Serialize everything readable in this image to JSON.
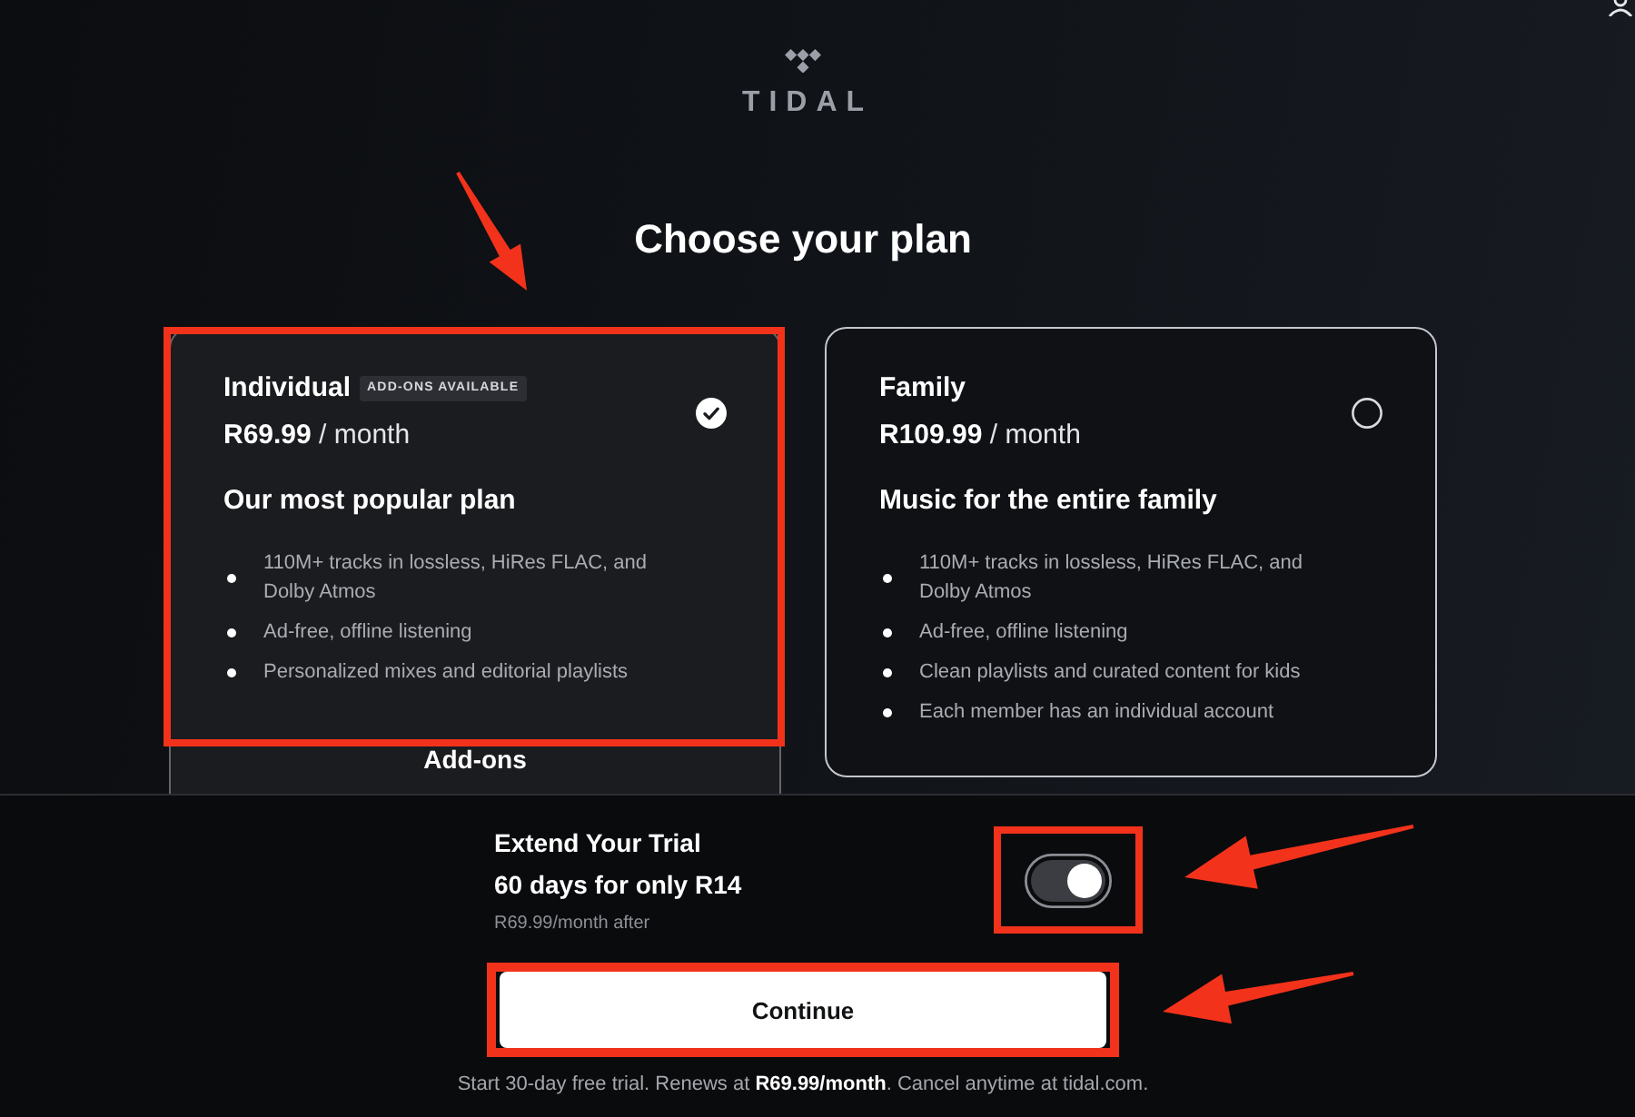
{
  "header": {
    "logo_text": "TIDAL",
    "title": "Choose your plan"
  },
  "plans": [
    {
      "name": "Individual",
      "badge": "ADD-ONS AVAILABLE",
      "price": "**R69.99** / month",
      "tagline": "Our most popular plan",
      "features": [
        "110M+ tracks in lossless, HiRes FLAC, and Dolby Atmos",
        "Ad-free, offline listening",
        "Personalized mixes and editorial playlists"
      ],
      "section_heading": "Add-ons",
      "selected": true
    },
    {
      "name": "Family",
      "price": "**R109.99** / month",
      "tagline": "Music for the entire family",
      "features": [
        "110M+ tracks in lossless, HiRes FLAC, and Dolby Atmos",
        "Ad-free, offline listening",
        "Clean playlists and curated content for kids",
        "Each member has an individual account"
      ],
      "selected": false
    }
  ],
  "trial_offer": {
    "title": "Extend Your Trial",
    "subtitle": "60 days for only R14",
    "note": "R69.99/month after",
    "on": true
  },
  "continue_button": {
    "label": "Continue"
  },
  "footer_text": "Start 30-day free trial. Renews at **R69.99/month**. Cancel anytime at tidal.com."
}
